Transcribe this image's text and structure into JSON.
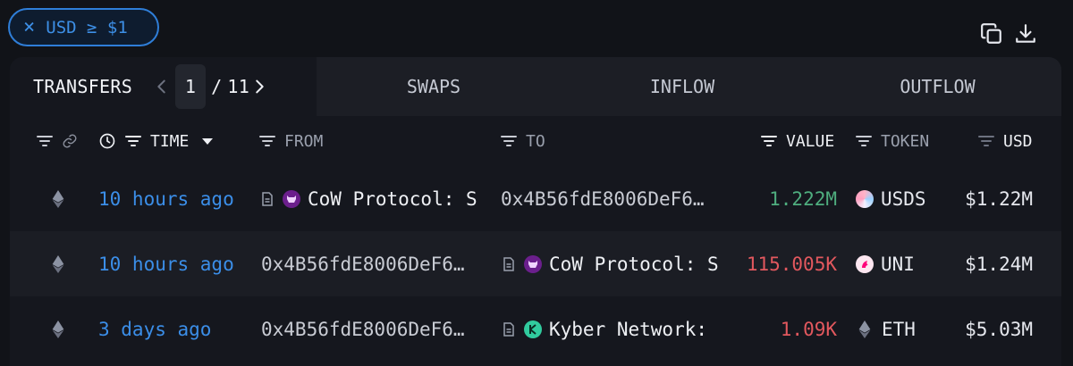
{
  "filter": {
    "label": "USD ≥ $1",
    "close_glyph": "×"
  },
  "tabs": {
    "transfers": "TRANSFERS",
    "page_current": "1",
    "page_sep": "/",
    "page_total": "11",
    "swaps": "SWAPS",
    "inflow": "INFLOW",
    "outflow": "OUTFLOW"
  },
  "columns": {
    "time": "TIME",
    "from": "FROM",
    "to": "TO",
    "value": "VALUE",
    "token": "TOKEN",
    "usd": "USD"
  },
  "rows": [
    {
      "time": "10 hours ago",
      "from": "CoW Protocol: S",
      "to": "0x4B56fdE8006DeF6…",
      "value": "1.222M",
      "token": "USDS",
      "usd": "$1.22M"
    },
    {
      "time": "10 hours ago",
      "from": "0x4B56fdE8006DeF6…",
      "to": "CoW Protocol: S",
      "value": "115.005K",
      "token": "UNI",
      "usd": "$1.24M"
    },
    {
      "time": "3 days ago",
      "from": "0x4B56fdE8006DeF6…",
      "to": "Kyber Network:",
      "value": "1.09K",
      "token": "ETH",
      "usd": "$5.03M"
    }
  ],
  "colors": {
    "accent": "#3b8ee8",
    "inflow": "#4fae7f",
    "outflow": "#e2585e",
    "cow_badge": "#6b1f8c",
    "kyber_badge": "#31cb9e",
    "uni_badge": "#ff007a"
  }
}
